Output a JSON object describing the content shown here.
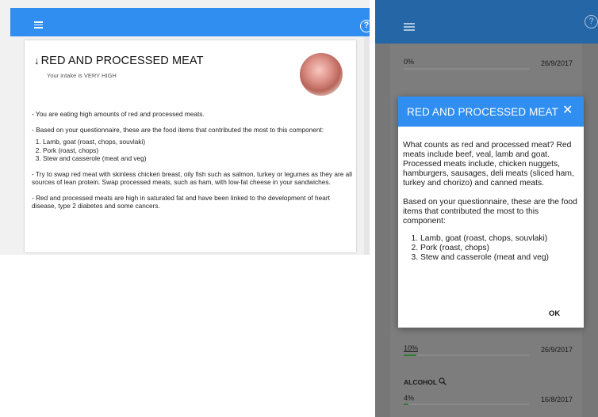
{
  "left_panel": {
    "card": {
      "title": "RED AND PROCESSED MEAT",
      "arrow": "↓",
      "subtitle": "Your intake is VERY HIGH",
      "paragraph_1": "- You are eating high amounts of red and processed meats.",
      "paragraph_2": "- Based on your questionnaire, these are the food items that contributed the most to this component:",
      "items": [
        "Lamb, goat (roast, chops, souvlaki)",
        "Pork (roast, chops)",
        "Stew and casserole (meat and veg)"
      ],
      "paragraph_3": "- Try to swap red meat with skinless chicken breast, oily fish such as salmon, turkey or legumes as they are all sources of lean protein. Swap processed meats, such as ham, with low-fat cheese in your sandwiches.",
      "paragraph_4": "- Red and processed meats are high in saturated fat and have been linked to the development of heart disease, type 2 diabetes and some cancers."
    },
    "help_glyph": "?"
  },
  "right_panel": {
    "help_glyph": "?",
    "rows": [
      {
        "value": "0%",
        "date": "26/9/2017",
        "progress": 0
      },
      {
        "value": "10%",
        "date": "26/9/2017",
        "progress": 0.1
      },
      {
        "value": "4%",
        "date": "16/8/2017",
        "progress": 0.04
      }
    ],
    "alcohol_label": "ALCOHOL",
    "dialog": {
      "title": "RED AND PROCESSED MEAT",
      "close": "✕",
      "paragraph_1": "What counts as red and processed meat? Red meats include beef, veal, lamb and goat. Processed meats include, chicken nuggets, hamburgers, sausages, deli meats (sliced ham, turkey and chorizo) and canned meats.",
      "paragraph_2": "Based on your questionnaire, these are the food items that contributed the most to this component:",
      "items": [
        "Lamb, goat (roast, chops, souvlaki)",
        "Pork (roast, chops)",
        "Stew and casserole (meat and veg)"
      ],
      "ok_label": "OK"
    }
  },
  "colors": {
    "app_bar": "#2f8ef0",
    "app_bar_dim": "#2466a6",
    "progress": "#2e7d32"
  }
}
